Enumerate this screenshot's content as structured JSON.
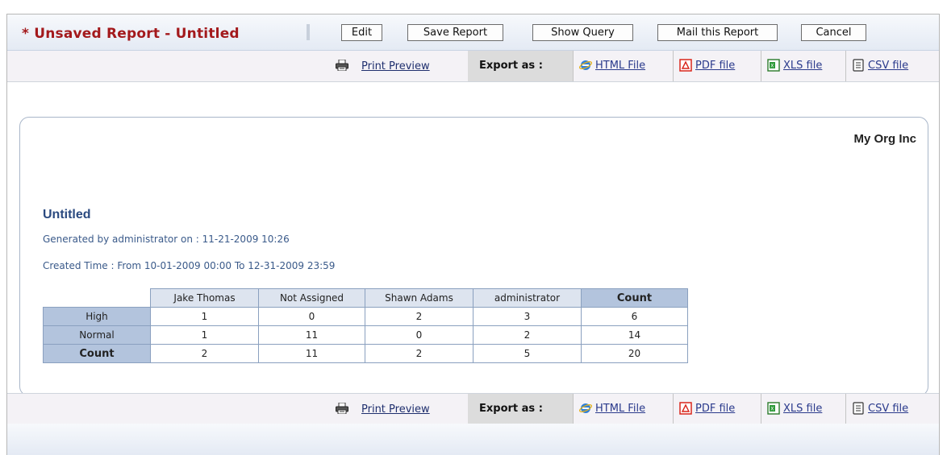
{
  "header": {
    "title": "* Unsaved Report - Untitled",
    "buttons": {
      "edit": "Edit",
      "save": "Save Report",
      "show_query": "Show Query",
      "mail": "Mail this Report",
      "cancel": "Cancel"
    }
  },
  "export_bar": {
    "print_preview": "Print Preview",
    "export_as": "Export as :",
    "html": "HTML File",
    "pdf": "PDF file",
    "xls": "XLS file",
    "csv": "CSV file"
  },
  "report": {
    "org": "My Org Inc",
    "title": "Untitled",
    "generated": "Generated by administrator on : 11-21-2009 10:26",
    "created_time": "Created Time : From 10-01-2009 00:00 To 12-31-2009 23:59",
    "table": {
      "columns": [
        "Jake Thomas",
        "Not Assigned",
        "Shawn Adams",
        "administrator",
        "Count"
      ],
      "rows": [
        {
          "label": "High",
          "values": [
            "1",
            "0",
            "2",
            "3",
            "6"
          ]
        },
        {
          "label": "Normal",
          "values": [
            "1",
            "11",
            "0",
            "2",
            "14"
          ]
        },
        {
          "label": "Count",
          "values": [
            "2",
            "11",
            "2",
            "5",
            "20"
          ]
        }
      ]
    }
  },
  "colors": {
    "title_red": "#a3191c",
    "link_blue": "#2a3a8c",
    "header_cell": "#dde4ef",
    "total_cell": "#b3c4dd"
  },
  "icons": {
    "print": "printer-icon",
    "html": "ie-icon",
    "pdf": "pdf-icon",
    "xls": "excel-icon",
    "csv": "csv-icon"
  }
}
